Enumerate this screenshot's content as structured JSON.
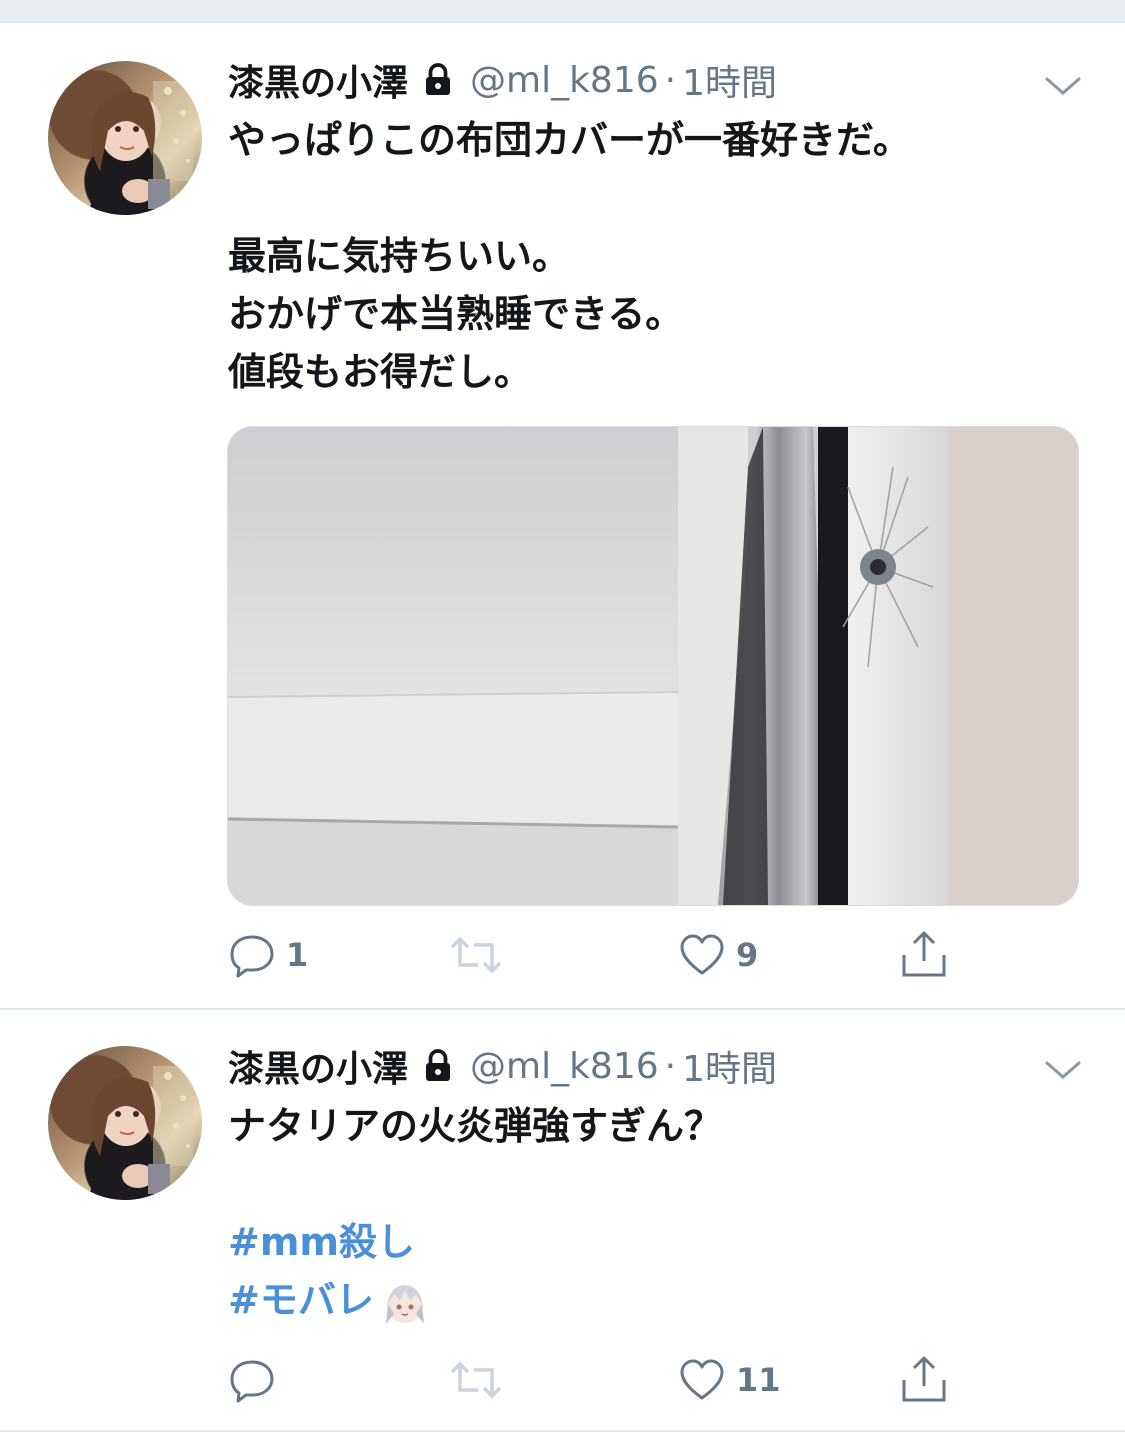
{
  "tweets": [
    {
      "author_name": "漆黒の小澤",
      "handle": "@ml_k816",
      "separator": "·",
      "time": "1時間",
      "text_lines": [
        "やっぱりこの布団カバーが一番好きだ。",
        "",
        "最高に気持ちいい。",
        "おかげで本当熟睡できる。",
        "値段もお得だし。"
      ],
      "media": "photo of white ceiling with curtain and sunburst wall clock",
      "reply_count": "1",
      "retweet_count": "",
      "like_count": "9"
    },
    {
      "author_name": "漆黒の小澤",
      "handle": "@ml_k816",
      "separator": "·",
      "time": "1時間",
      "text_lines": [
        "ナタリアの火炎弾強すぎん？",
        ""
      ],
      "hashtags": [
        "#mm殺し",
        "#モバレ"
      ],
      "reply_count": "",
      "retweet_count": "",
      "like_count": "11"
    }
  ],
  "colors": {
    "text": "#14171a",
    "secondary": "#657786",
    "hashtag": "#4a90d9",
    "divider": "#e1e8ed",
    "icon": "#657786",
    "retweet_disabled": "#c9d4dc"
  },
  "icons": [
    "lock-icon",
    "chevron-down-icon",
    "reply-icon",
    "retweet-icon",
    "like-icon",
    "share-icon"
  ]
}
